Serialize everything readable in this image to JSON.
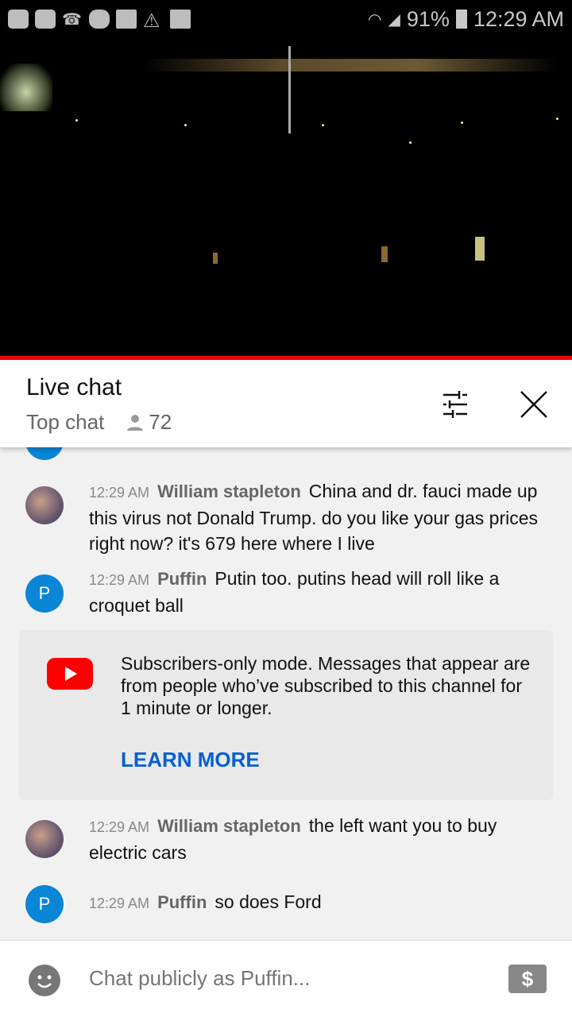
{
  "status_bar": {
    "battery": "91%",
    "time": "12:29 AM",
    "icons": [
      "youtube-icon",
      "youtube-icon",
      "missed-call-icon",
      "m-app-icon",
      "folder-icon",
      "warning-icon",
      "image-icon",
      "wifi-icon",
      "signal-icon",
      "battery-icon"
    ]
  },
  "chat_header": {
    "title": "Live chat",
    "mode": "Top chat",
    "viewers": "72",
    "icons": [
      "person-icon",
      "filter-icon",
      "close-icon"
    ]
  },
  "messages": [
    {
      "time": "12:29 AM",
      "author": "William stapleton",
      "text": "China and dr. fauci made up this virus not Donald Trump. do you like your gas prices right now? it's 679 here where I live",
      "avatar": "photo"
    },
    {
      "time": "12:29 AM",
      "author": "Puffin",
      "text": "Putin too. putins head will roll like a croquet ball",
      "avatar": "P"
    },
    {
      "time": "12:29 AM",
      "author": "William stapleton",
      "text": "the left want you to buy electric cars",
      "avatar": "photo"
    },
    {
      "time": "12:29 AM",
      "author": "Puffin",
      "text": "so does Ford",
      "avatar": "P"
    }
  ],
  "banner": {
    "text": "Subscribers-only mode. Messages that appear are from people who’ve subscribed to this channel for 1 minute or longer.",
    "link": "LEARN MORE"
  },
  "footer": {
    "placeholder": "Chat publicly as Puffin...",
    "super_chat": "$"
  },
  "colors": {
    "accent": "#ff0000",
    "link": "#065fd4",
    "avatar_blue": "#0b85d6"
  }
}
